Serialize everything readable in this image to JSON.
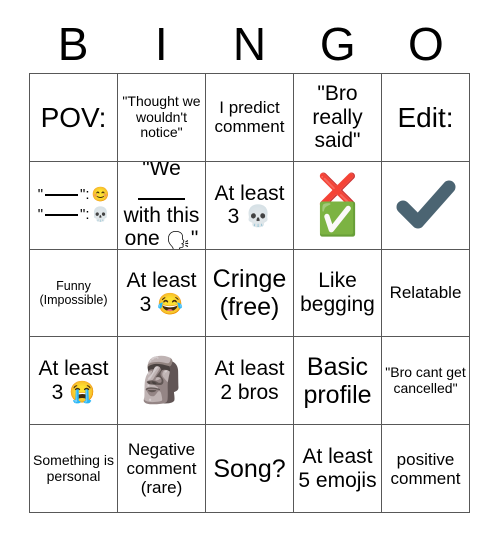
{
  "card": {
    "title": "BINGO",
    "header_letters": [
      "B",
      "I",
      "N",
      "G",
      "O"
    ],
    "grid_size": "5x5",
    "border_color": "#585858",
    "background_color": "#ffffff",
    "text_color": "#000000"
  },
  "cells": [
    {
      "row": 1,
      "col": 1,
      "column_letter": "B",
      "text": "POV:",
      "size": "xxl",
      "kind": "text"
    },
    {
      "row": 1,
      "col": 2,
      "column_letter": "I",
      "text": "\"Thought we wouldn't notice\"",
      "size": "sm",
      "kind": "text"
    },
    {
      "row": 1,
      "col": 3,
      "column_letter": "N",
      "text": "I predict comment",
      "size": "md",
      "kind": "text"
    },
    {
      "row": 1,
      "col": 4,
      "column_letter": "G",
      "text": "\"Bro really said\"",
      "size": "lg",
      "kind": "text"
    },
    {
      "row": 1,
      "col": 5,
      "column_letter": "O",
      "text": "Edit:",
      "size": "xxl",
      "kind": "text"
    },
    {
      "row": 2,
      "col": 1,
      "column_letter": "B",
      "kind": "blank-emoji-lines",
      "lines": [
        {
          "prefix": "\"",
          "blank": "___",
          "suffix": "\":",
          "emoji": "😊",
          "emoji_name": "smiling-face-emoji"
        },
        {
          "prefix": "\"",
          "blank": "___",
          "suffix": "\":",
          "emoji": "💀",
          "emoji_name": "skull-emoji"
        }
      ],
      "text": "\"___\": 😊  \"___\": 💀"
    },
    {
      "row": 2,
      "col": 2,
      "column_letter": "I",
      "kind": "fill-blank",
      "prefix": "\"We ",
      "blank": "___",
      "middle": " with this one ",
      "emoji": "🗣",
      "emoji_name": "speaking-head-emoji",
      "suffix": "\"",
      "size": "lg",
      "text": "\"We ___ with this one 🗣\""
    },
    {
      "row": 2,
      "col": 3,
      "column_letter": "N",
      "text": "At least 3 💀",
      "size": "lg",
      "kind": "text",
      "emoji_name": "skull-emoji"
    },
    {
      "row": 2,
      "col": 4,
      "column_letter": "G",
      "kind": "emoji-stack",
      "emojis": [
        "❌",
        "✅"
      ],
      "emoji_names": [
        "cross-mark-icon",
        "check-mark-button-icon"
      ],
      "text": "❌ ✅"
    },
    {
      "row": 2,
      "col": 5,
      "column_letter": "O",
      "kind": "check-icon",
      "emoji": "✔",
      "emoji_name": "heavy-check-mark-icon",
      "color": "#4b6472",
      "text": "✔"
    },
    {
      "row": 3,
      "col": 1,
      "column_letter": "B",
      "text": "Funny (Impossible)",
      "size": "xs",
      "kind": "text"
    },
    {
      "row": 3,
      "col": 2,
      "column_letter": "I",
      "text": "At least 3 😂",
      "size": "lg",
      "kind": "text",
      "emoji_name": "face-with-tears-of-joy-emoji"
    },
    {
      "row": 3,
      "col": 3,
      "column_letter": "N",
      "text": "Cringe (free)",
      "size": "xl",
      "kind": "text",
      "free_space": true
    },
    {
      "row": 3,
      "col": 4,
      "column_letter": "G",
      "text": "Like begging",
      "size": "lg",
      "kind": "text"
    },
    {
      "row": 3,
      "col": 5,
      "column_letter": "O",
      "text": "Relatable",
      "size": "md",
      "kind": "text"
    },
    {
      "row": 4,
      "col": 1,
      "column_letter": "B",
      "text": "At least 3 😭",
      "size": "lg",
      "kind": "text",
      "emoji_name": "loudly-crying-face-emoji"
    },
    {
      "row": 4,
      "col": 2,
      "column_letter": "I",
      "kind": "emoji-only",
      "emoji": "🗿",
      "emoji_name": "moai-emoji",
      "text": "🗿"
    },
    {
      "row": 4,
      "col": 3,
      "column_letter": "N",
      "text": "At least 2 bros",
      "size": "lg",
      "kind": "text"
    },
    {
      "row": 4,
      "col": 4,
      "column_letter": "G",
      "text": "Basic profile",
      "size": "xl",
      "kind": "text"
    },
    {
      "row": 4,
      "col": 5,
      "column_letter": "O",
      "text": "\"Bro cant get cancelled\"",
      "size": "sm",
      "kind": "text"
    },
    {
      "row": 5,
      "col": 1,
      "column_letter": "B",
      "text": "Something is personal",
      "size": "sm",
      "kind": "text"
    },
    {
      "row": 5,
      "col": 2,
      "column_letter": "I",
      "text": "Negative comment (rare)",
      "size": "md",
      "kind": "text"
    },
    {
      "row": 5,
      "col": 3,
      "column_letter": "N",
      "text": "Song?",
      "size": "xl",
      "kind": "text"
    },
    {
      "row": 5,
      "col": 4,
      "column_letter": "G",
      "text": "At least 5 emojis",
      "size": "lg",
      "kind": "text"
    },
    {
      "row": 5,
      "col": 5,
      "column_letter": "O",
      "text": "positive comment",
      "size": "md",
      "kind": "text"
    }
  ]
}
